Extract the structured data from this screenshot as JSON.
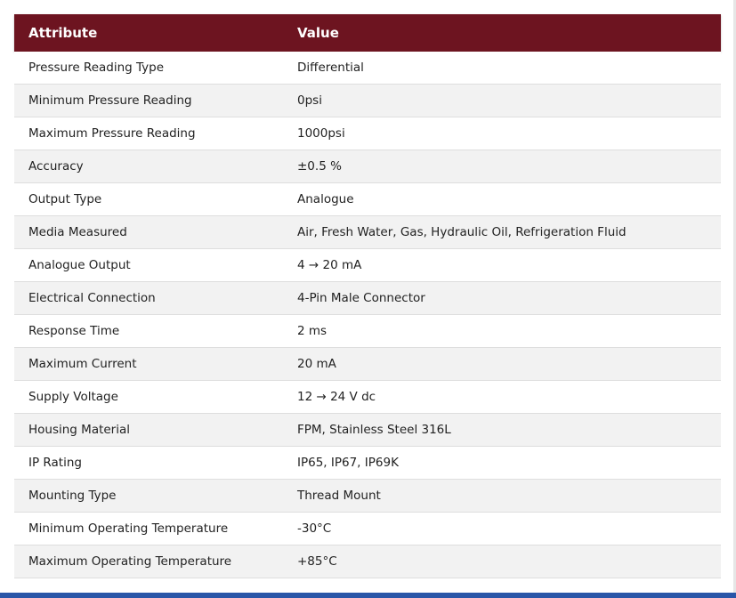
{
  "table": {
    "headers": {
      "attribute": "Attribute",
      "value": "Value"
    },
    "rows": [
      {
        "attribute": "Pressure Reading Type",
        "value": "Differential"
      },
      {
        "attribute": "Minimum Pressure Reading",
        "value": "0psi"
      },
      {
        "attribute": "Maximum Pressure Reading",
        "value": "1000psi"
      },
      {
        "attribute": "Accuracy",
        "value": "±0.5 %"
      },
      {
        "attribute": "Output Type",
        "value": "Analogue"
      },
      {
        "attribute": "Media Measured",
        "value": "Air, Fresh Water, Gas, Hydraulic Oil, Refrigeration Fluid"
      },
      {
        "attribute": "Analogue Output",
        "value": "4 → 20 mA"
      },
      {
        "attribute": "Electrical Connection",
        "value": "4-Pin Male Connector"
      },
      {
        "attribute": "Response Time",
        "value": "2 ms"
      },
      {
        "attribute": "Maximum Current",
        "value": "20 mA"
      },
      {
        "attribute": "Supply Voltage",
        "value": "12 → 24 V dc"
      },
      {
        "attribute": "Housing Material",
        "value": "FPM, Stainless Steel 316L"
      },
      {
        "attribute": "IP Rating",
        "value": "IP65, IP67, IP69K"
      },
      {
        "attribute": "Mounting Type",
        "value": "Thread Mount"
      },
      {
        "attribute": "Minimum Operating Temperature",
        "value": "-30°C"
      },
      {
        "attribute": "Maximum Operating Temperature",
        "value": "+85°C"
      }
    ]
  },
  "colors": {
    "header_bg": "#6d1420",
    "header_text": "#ffffff",
    "row_alt_bg": "#f2f2f2",
    "bottom_bar": "#2a56a8"
  }
}
